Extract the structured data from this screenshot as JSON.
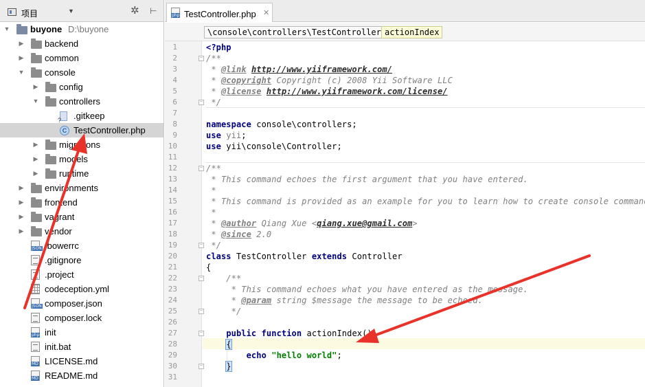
{
  "project_panel": {
    "title": "项目",
    "items": [
      {
        "label": "buyone",
        "path": "D:\\buyone",
        "depth": 0,
        "type": "root",
        "expanded": true
      },
      {
        "label": "backend",
        "depth": 1,
        "type": "folder",
        "expanded": false
      },
      {
        "label": "common",
        "depth": 1,
        "type": "folder",
        "expanded": false
      },
      {
        "label": "console",
        "depth": 1,
        "type": "folder",
        "expanded": true
      },
      {
        "label": "config",
        "depth": 2,
        "type": "folder",
        "expanded": false
      },
      {
        "label": "controllers",
        "depth": 2,
        "type": "folder",
        "expanded": true
      },
      {
        "label": ".gitkeep",
        "depth": 3,
        "type": "gitkeep"
      },
      {
        "label": "TestController.php",
        "depth": 3,
        "type": "class",
        "selected": true
      },
      {
        "label": "migrations",
        "depth": 2,
        "type": "folder",
        "expanded": false
      },
      {
        "label": "models",
        "depth": 2,
        "type": "folder",
        "expanded": false
      },
      {
        "label": "runtime",
        "depth": 2,
        "type": "folder",
        "expanded": false
      },
      {
        "label": "environments",
        "depth": 1,
        "type": "folder",
        "expanded": false
      },
      {
        "label": "frontend",
        "depth": 1,
        "type": "folder",
        "expanded": false
      },
      {
        "label": "vagrant",
        "depth": 1,
        "type": "folder",
        "expanded": false
      },
      {
        "label": "vendor",
        "depth": 1,
        "type": "folder",
        "expanded": false
      },
      {
        "label": ".bowerrc",
        "depth": 1,
        "type": "json"
      },
      {
        "label": ".gitignore",
        "depth": 1,
        "type": "text"
      },
      {
        "label": ".project",
        "depth": 1,
        "type": "text"
      },
      {
        "label": "codeception.yml",
        "depth": 1,
        "type": "grid"
      },
      {
        "label": "composer.json",
        "depth": 1,
        "type": "json"
      },
      {
        "label": "composer.lock",
        "depth": 1,
        "type": "text"
      },
      {
        "label": "init",
        "depth": 1,
        "type": "php"
      },
      {
        "label": "init.bat",
        "depth": 1,
        "type": "text"
      },
      {
        "label": "LICENSE.md",
        "depth": 1,
        "type": "md"
      },
      {
        "label": "README.md",
        "depth": 1,
        "type": "md"
      }
    ]
  },
  "editor": {
    "tab": {
      "label": "TestController.php",
      "icon": "php-file-icon"
    },
    "breadcrumbs": {
      "namespace": "\\console\\controllers\\TestController",
      "method": "actionIndex"
    },
    "line_numbers": [
      "1",
      "2",
      "3",
      "4",
      "5",
      "6",
      "7",
      "8",
      "9",
      "10",
      "11",
      "12",
      "13",
      "14",
      "15",
      "16",
      "17",
      "18",
      "19",
      "20",
      "21",
      "22",
      "23",
      "24",
      "25",
      "26",
      "27",
      "28",
      "29",
      "30",
      "31"
    ],
    "lines": {
      "l1": "<?php",
      "l2": "/**",
      "l3_pre": " * ",
      "l3_tag": "@link",
      "l3_sp": " ",
      "l3_url": "http://www.yiiframework.com/",
      "l4_pre": " * ",
      "l4_tag": "@copyright",
      "l4_rest": " Copyright (c) 2008 Yii Software LLC",
      "l5_pre": " * ",
      "l5_tag": "@license",
      "l5_sp": " ",
      "l5_url": "http://www.yiiframework.com/license/",
      "l6": " */",
      "l8_kw": "namespace",
      "l8_rest": " console\\controllers;",
      "l9_kw": "use",
      "l9_name": " yii",
      "l9_semi": ";",
      "l10_kw": "use",
      "l10_rest": " yii\\console\\Controller;",
      "l12": "/**",
      "l13": " * This command echoes the first argument that you have entered.",
      "l14": " *",
      "l15": " * This command is provided as an example for you to learn how to create console commands.",
      "l16": " *",
      "l17_pre": " * ",
      "l17_tag": "@author",
      "l17_rest": " Qiang Xue <",
      "l17_mail": "qiang.xue@gmail.com",
      "l17_end": ">",
      "l18_pre": " * ",
      "l18_tag": "@since",
      "l18_rest": " 2.0",
      "l19": " */",
      "l20_kw1": "class",
      "l20_name": " TestController ",
      "l20_kw2": "extends",
      "l20_rest": " Controller",
      "l21": "{",
      "l22": "    /**",
      "l23": "     * This command echoes what you have entered as the message.",
      "l24_pre": "     * ",
      "l24_tag": "@param",
      "l24_rest": " string $message the message to be echoed.",
      "l25": "     */",
      "l27_ind": "    ",
      "l27_kw1": "public",
      "l27_sp": " ",
      "l27_kw2": "function",
      "l27_rest": " actionIndex()",
      "l28_ind": "    ",
      "l28_brace": "{",
      "l29_ind": "        ",
      "l29_kw": "echo",
      "l29_sp": " ",
      "l29_str": "\"hello world\"",
      "l29_semi": ";",
      "l30_ind": "    ",
      "l30_brace": "}"
    }
  },
  "colors": {
    "annotation_arrow": "#e8322a",
    "keyword": "#000080",
    "string": "#008000",
    "comment": "#808080",
    "current_line": "#fcfae0"
  }
}
